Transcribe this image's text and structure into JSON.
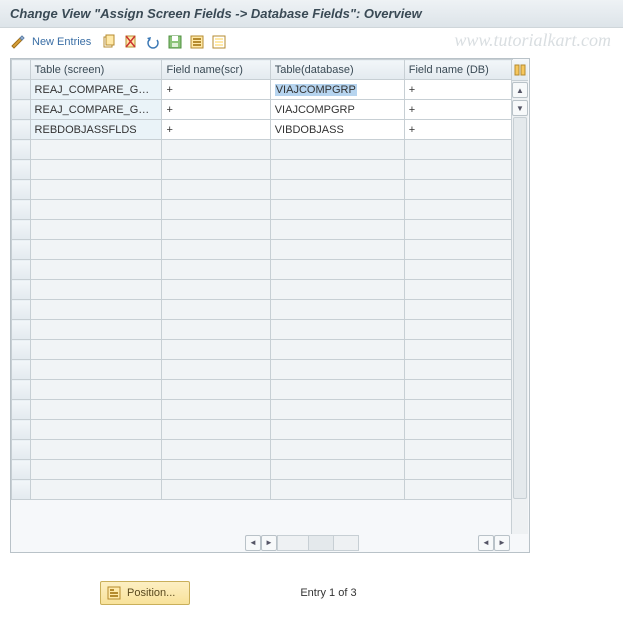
{
  "title": "Change View \"Assign Screen Fields -> Database Fields\": Overview",
  "watermark": "www.tutorialkart.com",
  "toolbar": {
    "new_entries": "New Entries"
  },
  "columns": {
    "c1": "Table (screen)",
    "c2": "Field name(scr)",
    "c3": "Table(database)",
    "c4": "Field name (DB)"
  },
  "rows": [
    {
      "table_screen": "REAJ_COMPARE_G…",
      "field_scr": "+",
      "table_db": "VIAJCOMPGRP",
      "field_db": "+"
    },
    {
      "table_screen": "REAJ_COMPARE_G…",
      "field_scr": "+",
      "table_db": "VIAJCOMPGRP",
      "field_db": "+"
    },
    {
      "table_screen": "REBDOBJASSFLDS",
      "field_scr": "+",
      "table_db": "VIBDOBJASS",
      "field_db": "+"
    }
  ],
  "footer": {
    "position_label": "Position...",
    "entry_text": "Entry 1 of 3"
  }
}
